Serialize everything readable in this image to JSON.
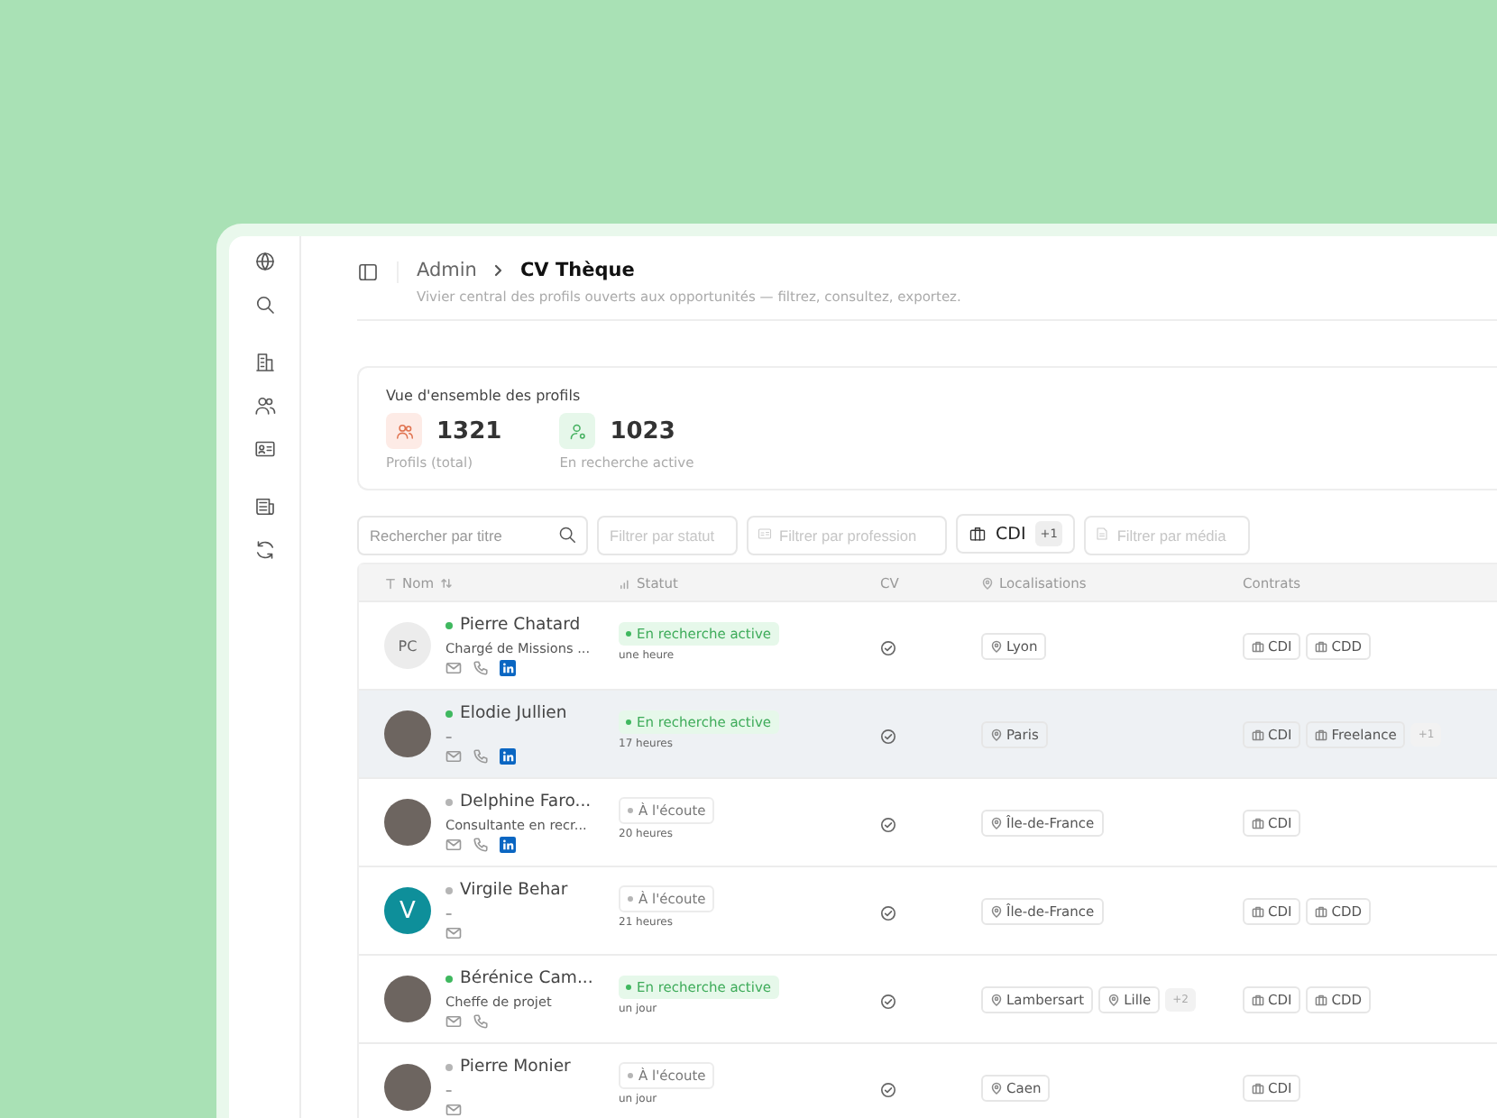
{
  "breadcrumb": {
    "parent": "Admin",
    "current": "CV Thèque"
  },
  "subtitle": "Vivier central des profils ouverts aux opportunités — filtrez, consultez, exportez.",
  "overview": {
    "title": "Vue d'ensemble des profils",
    "stats": [
      {
        "kind": "total",
        "value": "1321",
        "label": "Profils (total)"
      },
      {
        "kind": "active",
        "value": "1023",
        "label": "En recherche active"
      }
    ]
  },
  "filters": {
    "search_placeholder": "Rechercher par titre",
    "status_placeholder": "Filtrer par statut",
    "profession_placeholder": "Filtrer par profession",
    "contract_value": "CDI",
    "contract_extra": "+1",
    "media_placeholder": "Filtrer par média"
  },
  "table": {
    "columns": [
      "Nom",
      "Statut",
      "CV",
      "Localisations",
      "Contrats"
    ],
    "rows": [
      {
        "selected": false,
        "avatar": {
          "kind": "initials",
          "text": "PC"
        },
        "name": "Pierre Chatard",
        "subtitle": "Chargé de Missions ...",
        "contacts": {
          "email": true,
          "phone": true,
          "linkedin": true
        },
        "status": {
          "kind": "active",
          "label": "En recherche active"
        },
        "time": "une heure",
        "locations": [
          "Lyon"
        ],
        "locations_extra": "",
        "contracts": [
          "CDI",
          "CDD"
        ],
        "contracts_extra": ""
      },
      {
        "selected": true,
        "avatar": {
          "kind": "photo"
        },
        "name": "Elodie Jullien",
        "subtitle": "–",
        "contacts": {
          "email": true,
          "phone": true,
          "linkedin": true
        },
        "status": {
          "kind": "active",
          "label": "En recherche active"
        },
        "time": "17 heures",
        "locations": [
          "Paris"
        ],
        "locations_extra": "",
        "contracts": [
          "CDI",
          "Freelance"
        ],
        "contracts_extra": "+1"
      },
      {
        "selected": false,
        "avatar": {
          "kind": "photo"
        },
        "name": "Delphine Faro...",
        "subtitle": "Consultante en recr...",
        "contacts": {
          "email": true,
          "phone": true,
          "linkedin": true
        },
        "status": {
          "kind": "listening",
          "label": "À l'écoute"
        },
        "time": "20 heures",
        "locations": [
          "Île-de-France"
        ],
        "locations_extra": "",
        "contracts": [
          "CDI"
        ],
        "contracts_extra": ""
      },
      {
        "selected": false,
        "avatar": {
          "kind": "letter",
          "text": "V",
          "color": "#0e8f9a"
        },
        "name": "Virgile Behar",
        "subtitle": "–",
        "contacts": {
          "email": true,
          "phone": false,
          "linkedin": false
        },
        "status": {
          "kind": "listening",
          "label": "À l'écoute"
        },
        "time": "21 heures",
        "locations": [
          "Île-de-France"
        ],
        "locations_extra": "",
        "contracts": [
          "CDI",
          "CDD"
        ],
        "contracts_extra": ""
      },
      {
        "selected": false,
        "avatar": {
          "kind": "photo"
        },
        "name": "Bérénice Cam...",
        "subtitle": "Cheffe de projet",
        "contacts": {
          "email": true,
          "phone": true,
          "linkedin": false
        },
        "status": {
          "kind": "active",
          "label": "En recherche active"
        },
        "time": "un jour",
        "locations": [
          "Lambersart",
          "Lille"
        ],
        "locations_extra": "+2",
        "contracts": [
          "CDI",
          "CDD"
        ],
        "contracts_extra": ""
      },
      {
        "selected": false,
        "avatar": {
          "kind": "photo"
        },
        "name": "Pierre Monier",
        "subtitle": "–",
        "contacts": {
          "email": true,
          "phone": false,
          "linkedin": false
        },
        "status": {
          "kind": "listening",
          "label": "À l'écoute"
        },
        "time": "un jour",
        "locations": [
          "Caen"
        ],
        "locations_extra": "",
        "contracts": [
          "CDI"
        ],
        "contracts_extra": ""
      }
    ]
  }
}
